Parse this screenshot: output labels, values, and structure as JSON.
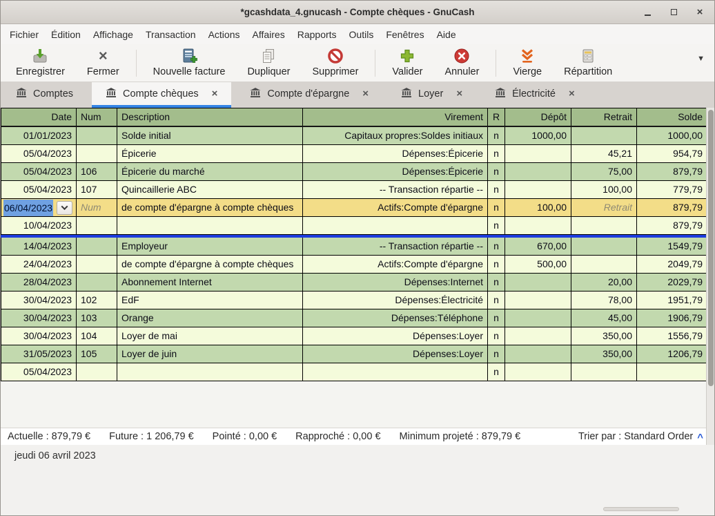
{
  "window": {
    "title": "*gcashdata_4.gnucash - Compte chèques - GnuCash",
    "controls": [
      "minimize-icon",
      "maximize-icon",
      "close-icon"
    ]
  },
  "menu": {
    "items": [
      "Fichier",
      "Édition",
      "Affichage",
      "Transaction",
      "Actions",
      "Affaires",
      "Rapports",
      "Outils",
      "Fenêtres",
      "Aide"
    ]
  },
  "toolbar": {
    "buttons": [
      {
        "label": "Enregistrer",
        "icon": "save-icon"
      },
      {
        "label": "Fermer",
        "icon": "close-x-icon"
      },
      {
        "label": "Nouvelle facture",
        "icon": "new-invoice-icon"
      },
      {
        "label": "Dupliquer",
        "icon": "duplicate-icon"
      },
      {
        "label": "Supprimer",
        "icon": "delete-icon"
      },
      {
        "label": "Valider",
        "icon": "validate-plus-icon"
      },
      {
        "label": "Annuler",
        "icon": "cancel-icon"
      },
      {
        "label": "Vierge",
        "icon": "blank-transaction-icon"
      },
      {
        "label": "Répartition",
        "icon": "split-icon"
      }
    ],
    "overflow_icon": "chevron-down-icon"
  },
  "tabs": [
    {
      "label": "Comptes",
      "icon": "bank-icon",
      "closable": false,
      "active": false
    },
    {
      "label": "Compte chèques",
      "icon": "bank-icon",
      "closable": true,
      "active": true
    },
    {
      "label": "Compte d'épargne",
      "icon": "bank-icon",
      "closable": true,
      "active": false
    },
    {
      "label": "Loyer",
      "icon": "bank-icon",
      "closable": true,
      "active": false
    },
    {
      "label": "Électricité",
      "icon": "bank-icon",
      "closable": true,
      "active": false
    }
  ],
  "register": {
    "columns": [
      {
        "label": "Date",
        "align": "right"
      },
      {
        "label": "Num",
        "align": "left"
      },
      {
        "label": "Description",
        "align": "left"
      },
      {
        "label": "Virement",
        "align": "right"
      },
      {
        "label": "R",
        "align": "center"
      },
      {
        "label": "Dépôt",
        "align": "right"
      },
      {
        "label": "Retrait",
        "align": "right"
      },
      {
        "label": "Solde",
        "align": "right"
      }
    ],
    "blue_separator_after": 5,
    "rows": [
      {
        "date": "01/01/2023",
        "num": "",
        "description": "Solde initial",
        "transfer": "Capitaux propres:Soldes initiaux",
        "r": "n",
        "deposit": "1000,00",
        "withdrawal": "",
        "balance": "1000,00",
        "variant": "green"
      },
      {
        "date": "05/04/2023",
        "num": "",
        "description": "Épicerie",
        "transfer": "Dépenses:Épicerie",
        "r": "n",
        "deposit": "",
        "withdrawal": "45,21",
        "balance": "954,79",
        "variant": "yellow"
      },
      {
        "date": "05/04/2023",
        "num": "106",
        "description": "Épicerie du marché",
        "transfer": "Dépenses:Épicerie",
        "r": "n",
        "deposit": "",
        "withdrawal": "75,00",
        "balance": "879,79",
        "variant": "green"
      },
      {
        "date": "05/04/2023",
        "num": "107",
        "description": "Quincaillerie ABC",
        "transfer": "-- Transaction répartie --",
        "r": "n",
        "deposit": "",
        "withdrawal": "100,00",
        "balance": "779,79",
        "variant": "yellow"
      },
      {
        "date": "06/04/2023",
        "num": "",
        "num_placeholder": "Num",
        "description": "de compte d'épargne à compte chèques",
        "transfer": "Actifs:Compte d'épargne",
        "r": "n",
        "deposit": "100,00",
        "withdrawal": "",
        "withdrawal_placeholder": "Retrait",
        "balance": "879,79",
        "variant": "selected"
      },
      {
        "date": "10/04/2023",
        "num": "",
        "description": "",
        "transfer": "",
        "r": "n",
        "deposit": "",
        "withdrawal": "",
        "balance": "879,79",
        "variant": "yellow"
      },
      {
        "date": "14/04/2023",
        "num": "",
        "description": "Employeur",
        "transfer": "-- Transaction répartie --",
        "r": "n",
        "deposit": "670,00",
        "withdrawal": "",
        "balance": "1549,79",
        "variant": "green"
      },
      {
        "date": "24/04/2023",
        "num": "",
        "description": "de compte d'épargne à compte chèques",
        "transfer": "Actifs:Compte d'épargne",
        "r": "n",
        "deposit": "500,00",
        "withdrawal": "",
        "balance": "2049,79",
        "variant": "yellow"
      },
      {
        "date": "28/04/2023",
        "num": "",
        "description": "Abonnement Internet",
        "transfer": "Dépenses:Internet",
        "r": "n",
        "deposit": "",
        "withdrawal": "20,00",
        "balance": "2029,79",
        "variant": "green"
      },
      {
        "date": "30/04/2023",
        "num": "102",
        "description": "EdF",
        "transfer": "Dépenses:Électricité",
        "r": "n",
        "deposit": "",
        "withdrawal": "78,00",
        "balance": "1951,79",
        "variant": "yellow"
      },
      {
        "date": "30/04/2023",
        "num": "103",
        "description": "Orange",
        "transfer": "Dépenses:Téléphone",
        "r": "n",
        "deposit": "",
        "withdrawal": "45,00",
        "balance": "1906,79",
        "variant": "green"
      },
      {
        "date": "30/04/2023",
        "num": "104",
        "description": "Loyer de mai",
        "transfer": "Dépenses:Loyer",
        "r": "n",
        "deposit": "",
        "withdrawal": "350,00",
        "balance": "1556,79",
        "variant": "yellow"
      },
      {
        "date": "31/05/2023",
        "num": "105",
        "description": "Loyer de juin",
        "transfer": "Dépenses:Loyer",
        "r": "n",
        "deposit": "",
        "withdrawal": "350,00",
        "balance": "1206,79",
        "variant": "green"
      },
      {
        "date": "05/04/2023",
        "num": "",
        "description": "",
        "transfer": "",
        "r": "n",
        "deposit": "",
        "withdrawal": "",
        "balance": "",
        "variant": "yellow"
      }
    ]
  },
  "status_bar": {
    "items": [
      "Actuelle : 879,79 €",
      "Future : 1 206,79 €",
      "Pointé : 0,00 €",
      "Rapproché : 0,00 €",
      "Minimum projeté : 879,79 €"
    ],
    "sort": "Trier par : Standard Order",
    "sort_icon": "chevron-up-icon"
  },
  "footer": {
    "date": "jeudi 06 avril 2023"
  }
}
